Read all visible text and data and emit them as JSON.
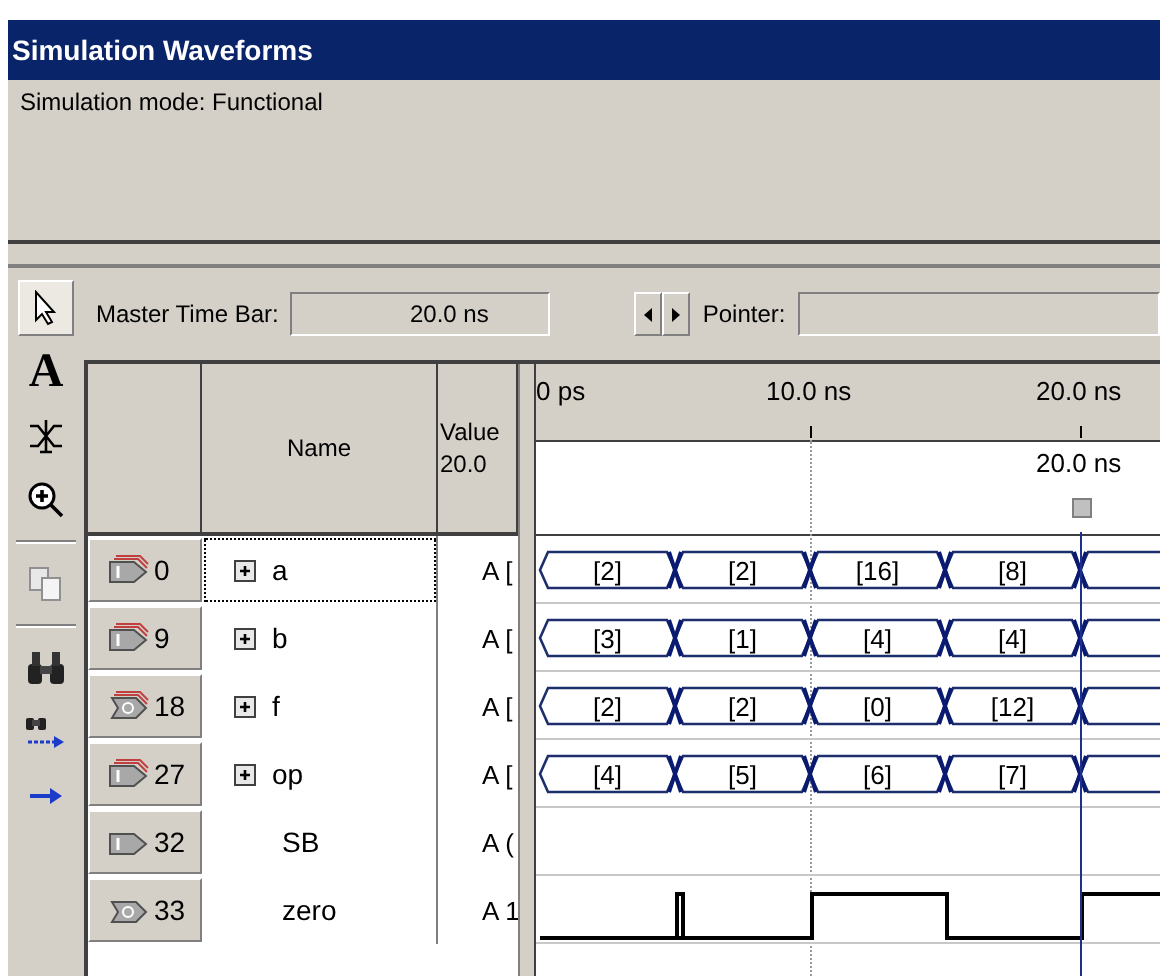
{
  "window": {
    "title": "Simulation Waveforms"
  },
  "mode_panel": {
    "text": "Simulation mode: Functional"
  },
  "toolbar": [
    {
      "kind": "pointer",
      "selected": true
    },
    {
      "kind": "text",
      "label": "A",
      "selected": false
    },
    {
      "kind": "waveform",
      "selected": false
    },
    {
      "kind": "zoom",
      "selected": false
    },
    {
      "kind": "separator"
    },
    {
      "kind": "copy",
      "selected": false
    },
    {
      "kind": "separator"
    },
    {
      "kind": "find",
      "selected": false
    },
    {
      "kind": "find-next",
      "selected": false
    },
    {
      "kind": "goto",
      "selected": false
    }
  ],
  "time_bar": {
    "label": "Master Time Bar:",
    "value": "20.0 ns",
    "pointer_label": "Pointer:"
  },
  "table": {
    "columns": [
      {
        "label": "Name"
      },
      {
        "label": "Value",
        "sub": "20.0"
      }
    ]
  },
  "ruler": [
    "0 ps",
    "10.0 ns",
    "20.0 ns"
  ],
  "cursor": {
    "label": "20.0 ns"
  },
  "signals": [
    {
      "id": "0",
      "name": "a",
      "value": "A [",
      "kind": "bus",
      "output": false,
      "selected": true,
      "continues": true,
      "segments": [
        {
          "label": "[2]"
        },
        {
          "label": "[2]"
        },
        {
          "label": "[16]"
        },
        {
          "label": "[8]"
        }
      ]
    },
    {
      "id": "9",
      "name": "b",
      "value": "A [",
      "kind": "bus",
      "output": false,
      "selected": false,
      "continues": true,
      "segments": [
        {
          "label": "[3]"
        },
        {
          "label": "[1]"
        },
        {
          "label": "[4]"
        },
        {
          "label": "[4]"
        }
      ]
    },
    {
      "id": "18",
      "name": "f",
      "value": "A [",
      "kind": "bus",
      "output": true,
      "selected": false,
      "continues": true,
      "segments": [
        {
          "label": "[2]"
        },
        {
          "label": "[2]"
        },
        {
          "label": "[0]"
        },
        {
          "label": "[12]"
        }
      ]
    },
    {
      "id": "27",
      "name": "op",
      "value": "A [",
      "kind": "bus",
      "output": false,
      "selected": false,
      "continues": true,
      "segments": [
        {
          "label": "[4]"
        },
        {
          "label": "[5]"
        },
        {
          "label": "[6]"
        },
        {
          "label": "[7]"
        }
      ]
    },
    {
      "id": "32",
      "name": "SB",
      "value": "A (",
      "kind": "bit",
      "output": false,
      "selected": false
    },
    {
      "id": "33",
      "name": "zero",
      "value": "A 1",
      "kind": "bit",
      "output": true,
      "selected": false,
      "segments": [
        {
          "high": false
        },
        {
          "high": false,
          "glitch": true
        },
        {
          "high": true
        },
        {
          "high": false
        },
        {
          "high": true
        }
      ]
    }
  ]
}
